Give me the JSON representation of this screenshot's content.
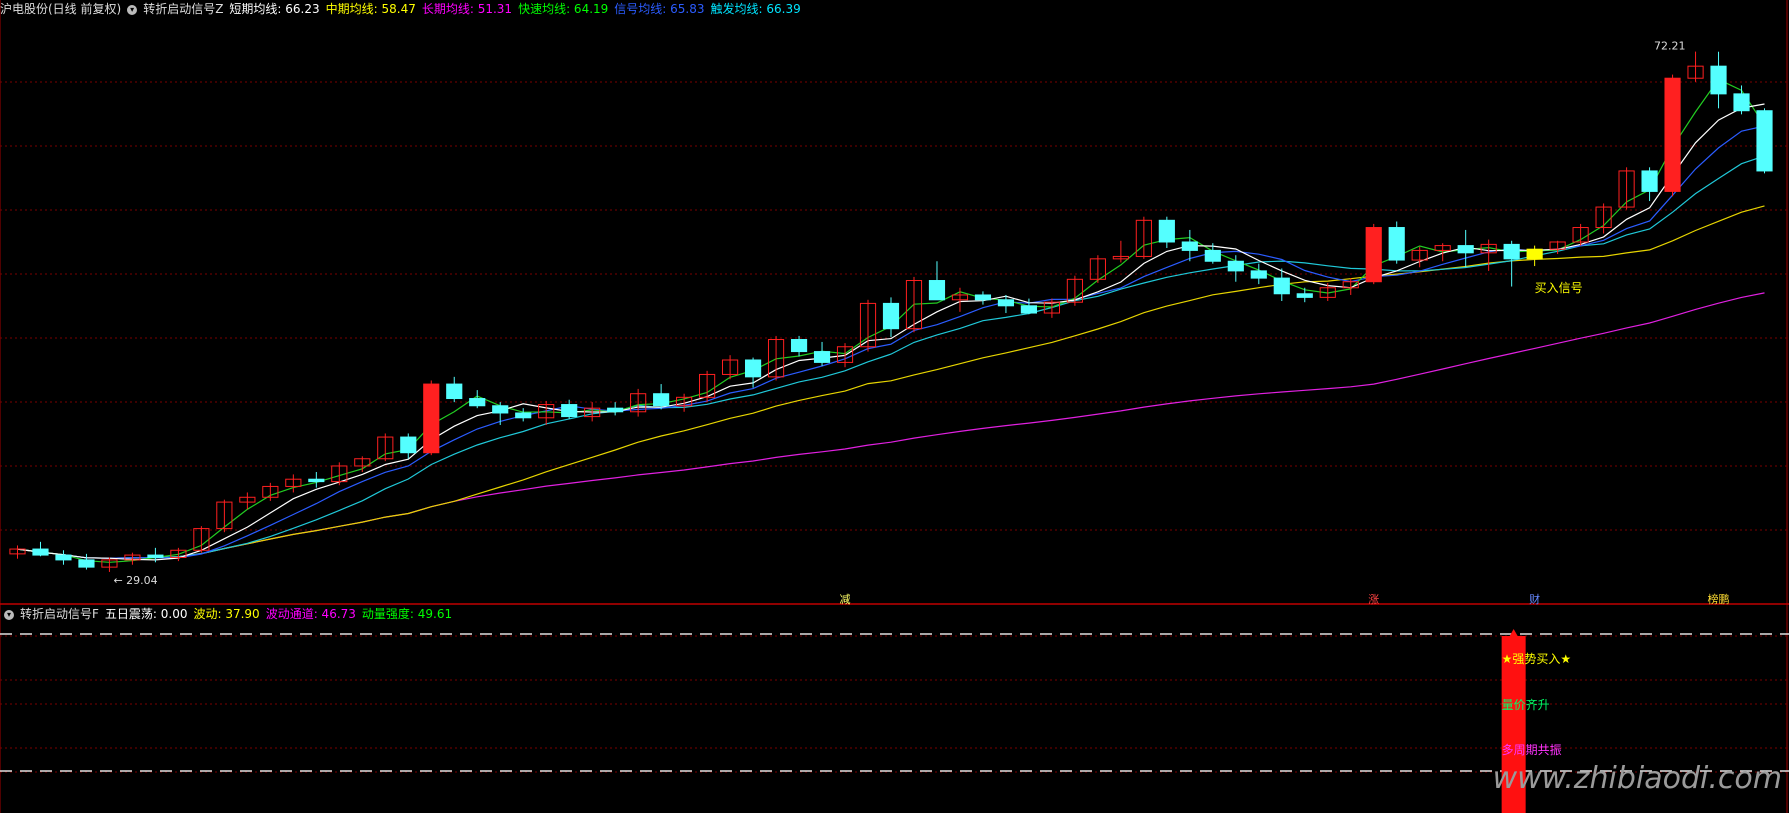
{
  "main_header": {
    "symbol": "沪电股份(日线 前复权)",
    "indicator_name": "转折启动信号Z",
    "items": [
      {
        "label": "短期均线:",
        "value": "66.23",
        "color": "#ffffff"
      },
      {
        "label": "中期均线:",
        "value": "58.47",
        "color": "#ffff00"
      },
      {
        "label": "长期均线:",
        "value": "51.31",
        "color": "#ff00ff"
      },
      {
        "label": "快速均线:",
        "value": "64.19",
        "color": "#00ff00"
      },
      {
        "label": "信号均线:",
        "value": "65.83",
        "color": "#2b5cff"
      },
      {
        "label": "触发均线:",
        "value": "66.39",
        "color": "#00e5ff"
      }
    ]
  },
  "sub_header": {
    "indicator_name": "转折启动信号F",
    "items": [
      {
        "label": "五日震荡:",
        "value": "0.00",
        "color": "#ffffff"
      },
      {
        "label": "波动:",
        "value": "37.90",
        "color": "#ffff00"
      },
      {
        "label": "波动通道:",
        "value": "46.73",
        "color": "#ff00ff"
      },
      {
        "label": "动量强度:",
        "value": "49.61",
        "color": "#00ff00"
      }
    ]
  },
  "annotations": {
    "high_label": "72.21",
    "low_label": "29.04",
    "buy_signal": "买入信号",
    "strong_buy": "★强势买入★",
    "volume_price": "量价齐升",
    "multi_cycle": "多周期共振",
    "watermark": "www.zhibiaodi.com"
  },
  "event_markers": [
    {
      "label": "减",
      "index": 36,
      "color": "#ffff66"
    },
    {
      "label": "涨",
      "index": 59,
      "color": "#ff4444"
    },
    {
      "label": "财",
      "index": 66,
      "color": "#6688ff"
    },
    {
      "label": "榜鹏",
      "index": 74,
      "color": "#ffdd33"
    }
  ],
  "colors": {
    "up": "#ff2020",
    "down": "#54ffff",
    "grid": "#7a0000",
    "ma_short": "#ffffff",
    "ma_mid": "#e6d400",
    "ma_long": "#e020e0",
    "ma_fast": "#22cc22",
    "ma_signal": "#2b5cff",
    "ma_trigger": "#20c8d8",
    "signal_bar": "#ff1010",
    "buy_box": "#ffff00"
  },
  "chart_data": {
    "type": "candlestick",
    "ylim": [
      27.5,
      75
    ],
    "ohlc": [
      [
        30.5,
        31.2,
        30.1,
        30.9
      ],
      [
        30.9,
        31.5,
        30.3,
        30.4
      ],
      [
        30.4,
        30.8,
        29.6,
        30.0
      ],
      [
        30.0,
        30.5,
        29.2,
        29.4
      ],
      [
        29.4,
        30.2,
        29.0,
        30.0
      ],
      [
        30.0,
        30.6,
        29.6,
        30.4
      ],
      [
        30.4,
        31.0,
        29.8,
        30.2
      ],
      [
        30.2,
        31.0,
        29.9,
        30.8
      ],
      [
        30.8,
        32.8,
        30.6,
        32.6
      ],
      [
        32.6,
        35.0,
        32.3,
        34.8
      ],
      [
        34.8,
        35.6,
        34.2,
        35.2
      ],
      [
        35.2,
        36.4,
        34.9,
        36.1
      ],
      [
        36.1,
        37.1,
        35.6,
        36.7
      ],
      [
        36.7,
        37.3,
        36.0,
        36.5
      ],
      [
        36.5,
        38.1,
        36.2,
        37.8
      ],
      [
        37.8,
        38.6,
        37.3,
        38.4
      ],
      [
        38.4,
        40.5,
        38.2,
        40.2
      ],
      [
        40.2,
        40.5,
        38.4,
        38.9
      ],
      [
        38.9,
        44.9,
        38.7,
        44.6
      ],
      [
        44.6,
        45.2,
        43.1,
        43.4
      ],
      [
        43.4,
        44.1,
        42.6,
        42.8
      ],
      [
        42.8,
        43.1,
        41.2,
        42.2
      ],
      [
        42.2,
        42.6,
        41.5,
        41.8
      ],
      [
        41.8,
        43.2,
        41.2,
        42.9
      ],
      [
        42.9,
        43.3,
        41.7,
        41.9
      ],
      [
        41.9,
        43.1,
        41.5,
        42.6
      ],
      [
        42.6,
        43.1,
        42.0,
        42.3
      ],
      [
        42.3,
        44.2,
        41.9,
        43.8
      ],
      [
        43.8,
        44.6,
        42.5,
        42.8
      ],
      [
        42.8,
        43.8,
        42.3,
        43.5
      ],
      [
        43.5,
        45.7,
        43.1,
        45.4
      ],
      [
        45.4,
        47.0,
        45.0,
        46.6
      ],
      [
        46.6,
        46.8,
        44.3,
        45.2
      ],
      [
        45.2,
        48.6,
        44.9,
        48.3
      ],
      [
        48.3,
        48.6,
        46.9,
        47.3
      ],
      [
        47.3,
        48.1,
        46.1,
        46.4
      ],
      [
        46.4,
        48.0,
        46.0,
        47.7
      ],
      [
        47.7,
        51.6,
        47.3,
        51.3
      ],
      [
        51.3,
        51.8,
        48.5,
        49.2
      ],
      [
        49.2,
        53.5,
        48.9,
        53.2
      ],
      [
        53.2,
        54.8,
        51.6,
        51.6
      ],
      [
        51.6,
        52.6,
        50.6,
        52.0
      ],
      [
        52.0,
        52.3,
        51.2,
        51.6
      ],
      [
        51.6,
        52.0,
        50.5,
        51.1
      ],
      [
        51.1,
        51.7,
        50.4,
        50.5
      ],
      [
        50.5,
        51.7,
        50.1,
        51.4
      ],
      [
        51.4,
        53.6,
        51.1,
        53.3
      ],
      [
        53.3,
        55.3,
        53.0,
        55.0
      ],
      [
        55.0,
        56.5,
        54.7,
        55.2
      ],
      [
        55.2,
        58.5,
        55.0,
        58.2
      ],
      [
        58.2,
        58.5,
        55.9,
        56.4
      ],
      [
        56.4,
        57.4,
        54.8,
        55.7
      ],
      [
        55.7,
        56.3,
        54.6,
        54.8
      ],
      [
        54.8,
        55.3,
        53.1,
        54.0
      ],
      [
        54.0,
        54.6,
        52.9,
        53.4
      ],
      [
        53.4,
        54.2,
        51.5,
        52.1
      ],
      [
        52.1,
        52.6,
        51.4,
        51.8
      ],
      [
        51.8,
        53.0,
        51.5,
        52.6
      ],
      [
        52.6,
        53.4,
        52.0,
        53.1
      ],
      [
        53.1,
        57.9,
        52.9,
        57.6
      ],
      [
        57.6,
        58.1,
        54.6,
        54.9
      ],
      [
        54.9,
        56.0,
        54.3,
        55.7
      ],
      [
        55.7,
        56.3,
        54.8,
        56.1
      ],
      [
        56.1,
        57.4,
        54.3,
        55.5
      ],
      [
        55.5,
        56.6,
        54.0,
        56.2
      ],
      [
        56.2,
        56.5,
        52.7,
        55.0
      ],
      [
        55.0,
        56.1,
        54.4,
        55.8
      ],
      [
        55.8,
        56.5,
        55.4,
        56.4
      ],
      [
        56.4,
        57.9,
        56.1,
        57.6
      ],
      [
        57.6,
        59.6,
        57.1,
        59.3
      ],
      [
        59.3,
        62.6,
        59.1,
        62.3
      ],
      [
        62.3,
        62.6,
        59.8,
        60.6
      ],
      [
        60.6,
        70.3,
        60.2,
        70.0
      ],
      [
        70.0,
        72.21,
        69.7,
        71.0
      ],
      [
        71.0,
        72.2,
        67.5,
        68.7
      ],
      [
        68.7,
        69.4,
        67.0,
        67.3
      ],
      [
        67.3,
        67.5,
        62.1,
        62.3
      ]
    ],
    "buy_signal_index": 66,
    "strong_buy_index": 65
  }
}
